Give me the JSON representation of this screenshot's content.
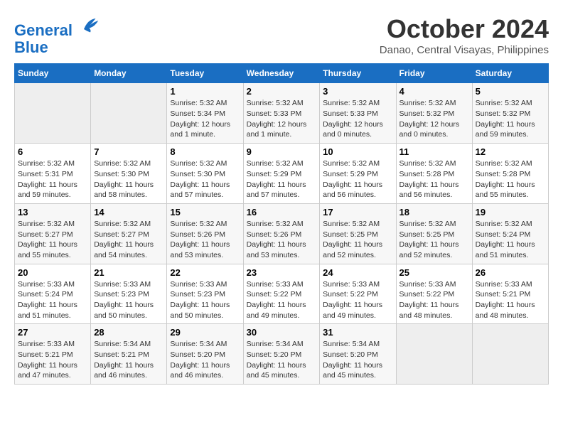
{
  "logo": {
    "line1": "General",
    "line2": "Blue"
  },
  "title": "October 2024",
  "location": "Danao, Central Visayas, Philippines",
  "weekdays": [
    "Sunday",
    "Monday",
    "Tuesday",
    "Wednesday",
    "Thursday",
    "Friday",
    "Saturday"
  ],
  "weeks": [
    [
      {
        "day": "",
        "info": ""
      },
      {
        "day": "",
        "info": ""
      },
      {
        "day": "1",
        "info": "Sunrise: 5:32 AM\nSunset: 5:34 PM\nDaylight: 12 hours and 1 minute."
      },
      {
        "day": "2",
        "info": "Sunrise: 5:32 AM\nSunset: 5:33 PM\nDaylight: 12 hours and 1 minute."
      },
      {
        "day": "3",
        "info": "Sunrise: 5:32 AM\nSunset: 5:33 PM\nDaylight: 12 hours and 0 minutes."
      },
      {
        "day": "4",
        "info": "Sunrise: 5:32 AM\nSunset: 5:32 PM\nDaylight: 12 hours and 0 minutes."
      },
      {
        "day": "5",
        "info": "Sunrise: 5:32 AM\nSunset: 5:32 PM\nDaylight: 11 hours and 59 minutes."
      }
    ],
    [
      {
        "day": "6",
        "info": "Sunrise: 5:32 AM\nSunset: 5:31 PM\nDaylight: 11 hours and 59 minutes."
      },
      {
        "day": "7",
        "info": "Sunrise: 5:32 AM\nSunset: 5:30 PM\nDaylight: 11 hours and 58 minutes."
      },
      {
        "day": "8",
        "info": "Sunrise: 5:32 AM\nSunset: 5:30 PM\nDaylight: 11 hours and 57 minutes."
      },
      {
        "day": "9",
        "info": "Sunrise: 5:32 AM\nSunset: 5:29 PM\nDaylight: 11 hours and 57 minutes."
      },
      {
        "day": "10",
        "info": "Sunrise: 5:32 AM\nSunset: 5:29 PM\nDaylight: 11 hours and 56 minutes."
      },
      {
        "day": "11",
        "info": "Sunrise: 5:32 AM\nSunset: 5:28 PM\nDaylight: 11 hours and 56 minutes."
      },
      {
        "day": "12",
        "info": "Sunrise: 5:32 AM\nSunset: 5:28 PM\nDaylight: 11 hours and 55 minutes."
      }
    ],
    [
      {
        "day": "13",
        "info": "Sunrise: 5:32 AM\nSunset: 5:27 PM\nDaylight: 11 hours and 55 minutes."
      },
      {
        "day": "14",
        "info": "Sunrise: 5:32 AM\nSunset: 5:27 PM\nDaylight: 11 hours and 54 minutes."
      },
      {
        "day": "15",
        "info": "Sunrise: 5:32 AM\nSunset: 5:26 PM\nDaylight: 11 hours and 53 minutes."
      },
      {
        "day": "16",
        "info": "Sunrise: 5:32 AM\nSunset: 5:26 PM\nDaylight: 11 hours and 53 minutes."
      },
      {
        "day": "17",
        "info": "Sunrise: 5:32 AM\nSunset: 5:25 PM\nDaylight: 11 hours and 52 minutes."
      },
      {
        "day": "18",
        "info": "Sunrise: 5:32 AM\nSunset: 5:25 PM\nDaylight: 11 hours and 52 minutes."
      },
      {
        "day": "19",
        "info": "Sunrise: 5:32 AM\nSunset: 5:24 PM\nDaylight: 11 hours and 51 minutes."
      }
    ],
    [
      {
        "day": "20",
        "info": "Sunrise: 5:33 AM\nSunset: 5:24 PM\nDaylight: 11 hours and 51 minutes."
      },
      {
        "day": "21",
        "info": "Sunrise: 5:33 AM\nSunset: 5:23 PM\nDaylight: 11 hours and 50 minutes."
      },
      {
        "day": "22",
        "info": "Sunrise: 5:33 AM\nSunset: 5:23 PM\nDaylight: 11 hours and 50 minutes."
      },
      {
        "day": "23",
        "info": "Sunrise: 5:33 AM\nSunset: 5:22 PM\nDaylight: 11 hours and 49 minutes."
      },
      {
        "day": "24",
        "info": "Sunrise: 5:33 AM\nSunset: 5:22 PM\nDaylight: 11 hours and 49 minutes."
      },
      {
        "day": "25",
        "info": "Sunrise: 5:33 AM\nSunset: 5:22 PM\nDaylight: 11 hours and 48 minutes."
      },
      {
        "day": "26",
        "info": "Sunrise: 5:33 AM\nSunset: 5:21 PM\nDaylight: 11 hours and 48 minutes."
      }
    ],
    [
      {
        "day": "27",
        "info": "Sunrise: 5:33 AM\nSunset: 5:21 PM\nDaylight: 11 hours and 47 minutes."
      },
      {
        "day": "28",
        "info": "Sunrise: 5:34 AM\nSunset: 5:21 PM\nDaylight: 11 hours and 46 minutes."
      },
      {
        "day": "29",
        "info": "Sunrise: 5:34 AM\nSunset: 5:20 PM\nDaylight: 11 hours and 46 minutes."
      },
      {
        "day": "30",
        "info": "Sunrise: 5:34 AM\nSunset: 5:20 PM\nDaylight: 11 hours and 45 minutes."
      },
      {
        "day": "31",
        "info": "Sunrise: 5:34 AM\nSunset: 5:20 PM\nDaylight: 11 hours and 45 minutes."
      },
      {
        "day": "",
        "info": ""
      },
      {
        "day": "",
        "info": ""
      }
    ]
  ]
}
